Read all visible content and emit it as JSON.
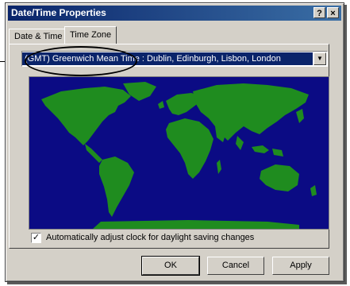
{
  "window": {
    "title": "Date/Time Properties",
    "help_label": "?",
    "close_label": "×"
  },
  "tabs": [
    {
      "label": "Date & Time",
      "selected": false
    },
    {
      "label": "Time Zone",
      "selected": true
    }
  ],
  "timezone": {
    "value": "(GMT) Greenwich Mean Time : Dublin, Edinburgh, Lisbon, London"
  },
  "map": {
    "ocean_color": "#0b0b84",
    "land_color": "#1f8c1f"
  },
  "daylight": {
    "checked": true,
    "check_mark": "✓",
    "label": "Automatically adjust clock for daylight saving changes"
  },
  "buttons": {
    "ok": "OK",
    "cancel": "Cancel",
    "apply": "Apply"
  },
  "icons": {
    "dropdown_arrow": "▼"
  }
}
